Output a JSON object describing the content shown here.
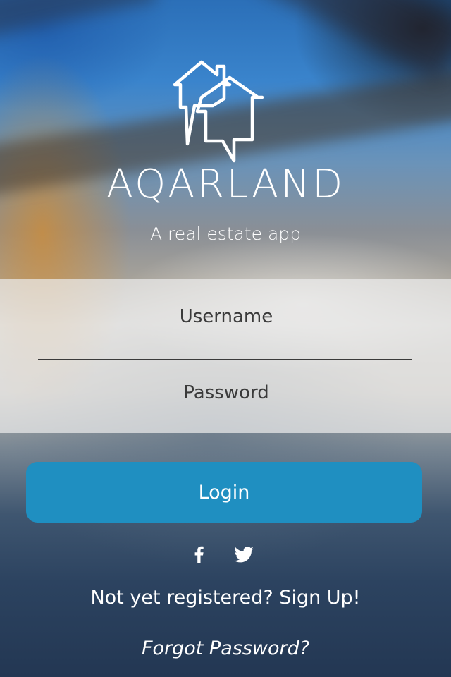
{
  "app": {
    "name": "AQARLAND",
    "tagline": "A real estate app",
    "logo_icon": "house-speech-bubbles-icon"
  },
  "login_form": {
    "username_placeholder": "Username",
    "username_value": "",
    "password_placeholder": "Password",
    "password_value": "",
    "login_label": "Login"
  },
  "social": [
    {
      "name": "facebook",
      "icon": "facebook-icon"
    },
    {
      "name": "twitter",
      "icon": "twitter-icon"
    }
  ],
  "links": {
    "signup_text": "Not yet registered? Sign Up!",
    "forgot_text": "Forgot Password?"
  },
  "colors": {
    "accent": "#1f8fc1",
    "text": "#ffffff",
    "form_band": "#ebebeb"
  }
}
